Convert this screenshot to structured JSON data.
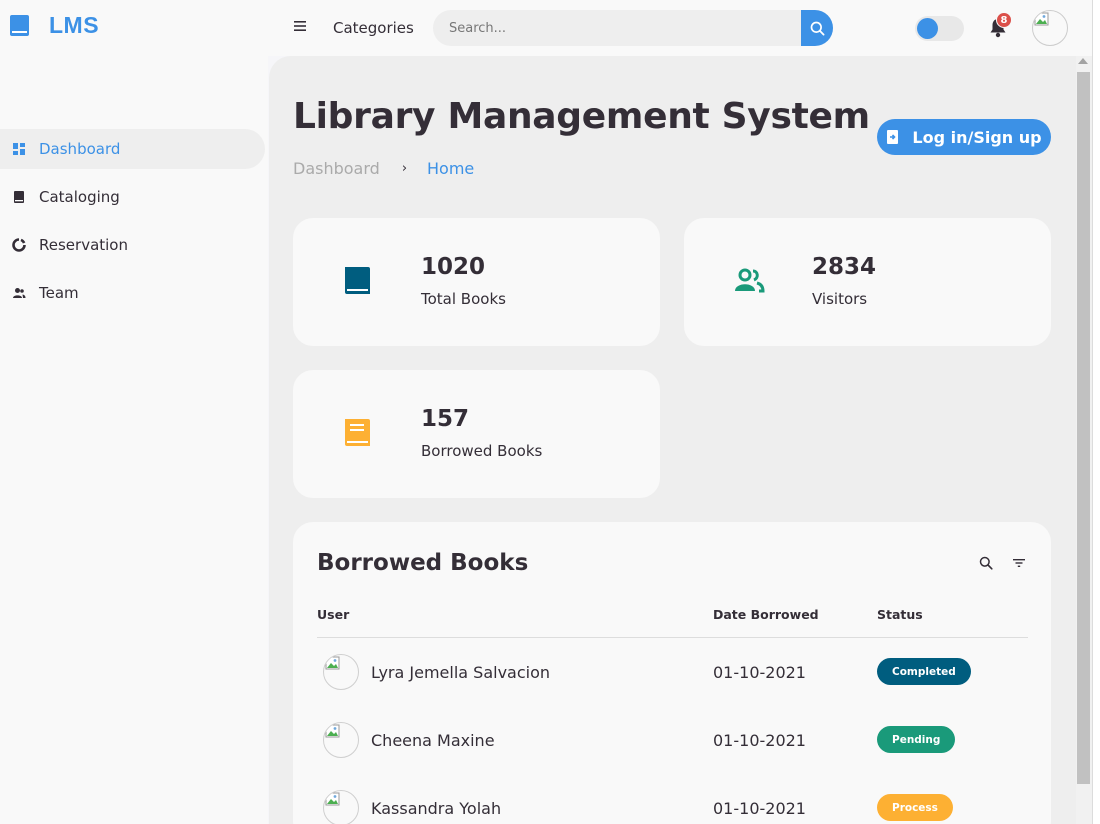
{
  "brand": {
    "name": "LMS",
    "icon": "book-icon"
  },
  "topbar": {
    "categories_label": "Categories",
    "search_placeholder": "Search...",
    "notification_count": "8"
  },
  "sidebar": {
    "items": [
      {
        "label": "Dashboard",
        "icon": "dashboard-icon",
        "active": true
      },
      {
        "label": "Cataloging",
        "icon": "book-icon",
        "active": false
      },
      {
        "label": "Reservation",
        "icon": "donut-chart-icon",
        "active": false
      },
      {
        "label": "Team",
        "icon": "team-icon",
        "active": false
      }
    ]
  },
  "header": {
    "title": "Library Management System",
    "breadcrumb": [
      "Dashboard",
      "›",
      "Home"
    ],
    "login_label": "Log in/Sign up"
  },
  "stats": [
    {
      "value": "1020",
      "label": "Total Books",
      "icon": "book-icon",
      "color": "#005d7f"
    },
    {
      "value": "2834",
      "label": "Visitors",
      "icon": "users-icon",
      "color": "#1a9a7a"
    },
    {
      "value": "157",
      "label": "Borrowed Books",
      "icon": "book-icon",
      "color": "#fdb033"
    }
  ],
  "borrowed": {
    "title": "Borrowed Books",
    "columns": [
      "User",
      "Date Borrowed",
      "Status"
    ],
    "rows": [
      {
        "user": "Lyra Jemella Salvacion",
        "date": "01-10-2021",
        "status": "Completed",
        "status_color": "#005d7f"
      },
      {
        "user": "Cheena Maxine",
        "date": "01-10-2021",
        "status": "Pending",
        "status_color": "#1a9a7a"
      },
      {
        "user": "Kassandra Yolah",
        "date": "01-10-2021",
        "status": "Process",
        "status_color": "#fdb033"
      }
    ]
  },
  "colors": {
    "accent": "#3c91e6",
    "danger": "#db504a",
    "text": "#342e37"
  }
}
